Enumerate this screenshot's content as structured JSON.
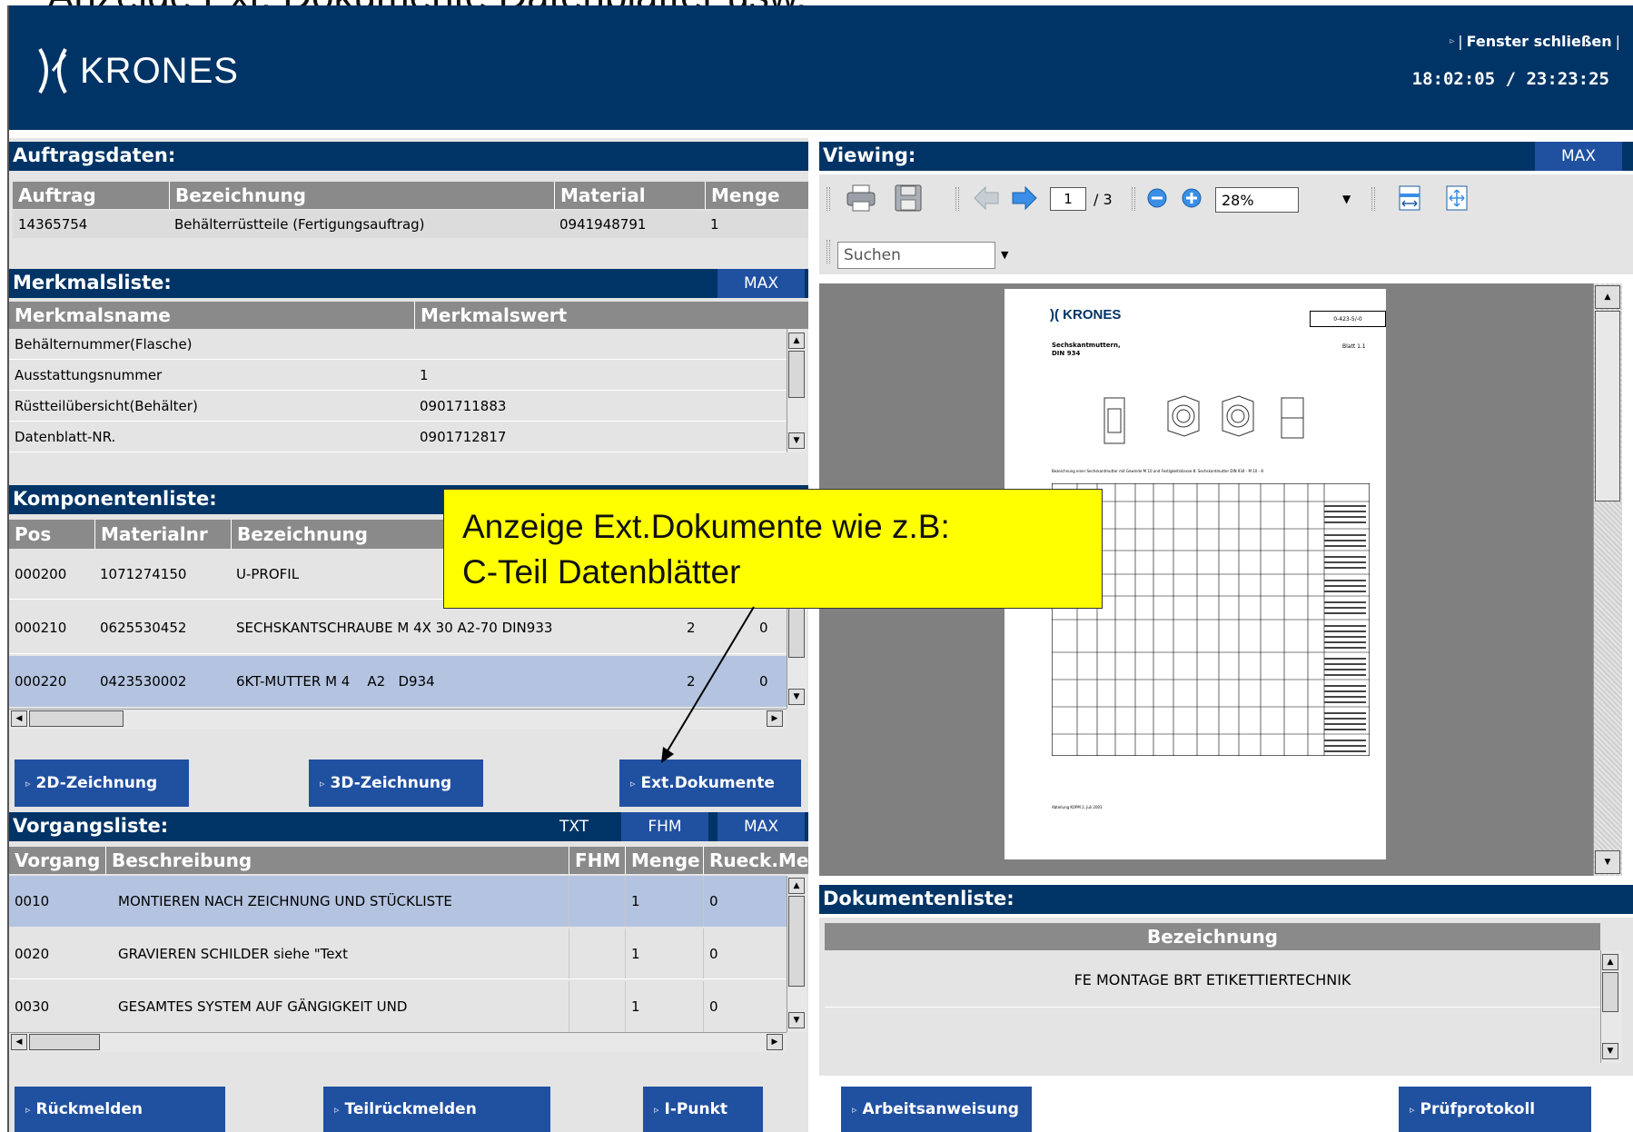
{
  "slide_title": "Anzeige Ext. Dokumente Datenblätter usw.",
  "header": {
    "logo_text": "KRONES",
    "close_link": "Fenster schließen",
    "close_sep_left": "|",
    "close_sep_right": "|",
    "time": "18:02:05 / 23:23:25"
  },
  "auftragsdaten": {
    "title": "Auftragsdaten:",
    "columns": [
      "Auftrag",
      "Bezeichnung",
      "Material",
      "Menge"
    ],
    "row": [
      "14365754",
      "Behälterrüstteile (Fertigungsauftrag)",
      "0941948791",
      "1"
    ]
  },
  "merkmalsliste": {
    "title": "Merkmalsliste:",
    "max": "MAX",
    "columns": [
      "Merkmalsname",
      "Merkmalswert"
    ],
    "rows": [
      [
        "Behälternummer(Flasche)",
        ""
      ],
      [
        "Ausstattungsnummer",
        "1"
      ],
      [
        "Rüstteilübersicht(Behälter)",
        "0901711883"
      ],
      [
        "Datenblatt-NR.",
        "0901712817"
      ]
    ]
  },
  "komponentenliste": {
    "title": "Komponentenliste:",
    "columns": [
      "Pos",
      "Materialnr",
      "Bezeichnung"
    ],
    "rows": [
      [
        "000200",
        "1071274150",
        "U-PROFIL",
        "",
        ""
      ],
      [
        "000210",
        "0625530452",
        "SECHSKANTSCHRAUBE M 4X 30 A2-70 DIN933",
        "2",
        "0"
      ],
      [
        "000220",
        "0423530002",
        "6KT-MUTTER M 4    A2   D934",
        "2",
        "0"
      ]
    ]
  },
  "callout": {
    "line1": "Anzeige Ext.Dokumente wie z.B:",
    "line2": "C-Teil Datenblätter"
  },
  "buttons_mid": [
    "2D-Zeichnung",
    "3D-Zeichnung",
    "Ext.Dokumente"
  ],
  "vorgangsliste": {
    "title": "Vorgangsliste:",
    "tabs": [
      "TXT",
      "FHM",
      "MAX"
    ],
    "columns": [
      "Vorgang",
      "Beschreibung",
      "FHM",
      "Menge",
      "Rueck.Meng"
    ],
    "rows": [
      [
        "0010",
        "MONTIEREN NACH ZEICHNUNG UND STÜCKLISTE",
        "",
        "1",
        "0"
      ],
      [
        "0020",
        "GRAVIEREN SCHILDER siehe \"Text",
        "",
        "1",
        "0"
      ],
      [
        "0030",
        "GESAMTES SYSTEM AUF GÄNGIGKEIT UND",
        "",
        "1",
        "0"
      ]
    ]
  },
  "buttons_bottom": [
    "Rückmelden",
    "Teilrückmelden",
    "I-Punkt",
    "Arbeitsanweisung",
    "Prüfprotokoll"
  ],
  "viewing": {
    "title": "Viewing:",
    "max": "MAX",
    "page_current": "1",
    "page_total": "/ 3",
    "zoom": "28%",
    "search_placeholder": "Suchen"
  },
  "document_preview": {
    "logo": "KRONES",
    "doc_number": "0-423-5/-0",
    "heading1": "Sechskantmuttern,",
    "heading2": "DIN 934",
    "blatt": "Blatt 1.1",
    "note": "Bezeichnung einer Sechskantmutter mit Gewinde M 10 und Festigkeitsklasse 8: Sechskantmutter DIN 934 - M 10 - 8",
    "footer": "Abteilung KOPM 2, Juli 2003"
  },
  "dokumentenliste": {
    "title": "Dokumentenliste:",
    "column": "Bezeichnung",
    "rows": [
      "FE MONTAGE BRT ETIKETTIERTECHNIK"
    ]
  },
  "icons": [
    "print-icon",
    "save-icon",
    "arrow-left-icon",
    "arrow-right-icon",
    "zoom-out-icon",
    "zoom-in-icon",
    "fit-width-icon",
    "fit-page-icon"
  ]
}
